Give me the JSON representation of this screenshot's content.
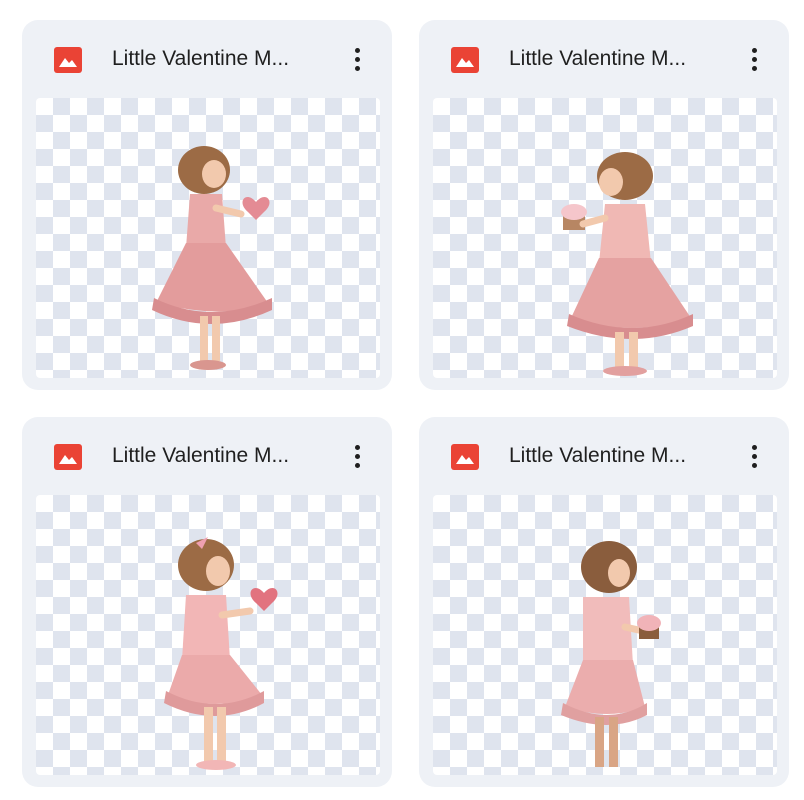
{
  "files": [
    {
      "title": "Little Valentine M...",
      "icon": "image-file-icon",
      "icon_color": "#ea4335",
      "thumbnail": "girl-holding-heart"
    },
    {
      "title": "Little Valentine M...",
      "icon": "image-file-icon",
      "icon_color": "#ea4335",
      "thumbnail": "girl-holding-cupcake"
    },
    {
      "title": "Little Valentine M...",
      "icon": "image-file-icon",
      "icon_color": "#ea4335",
      "thumbnail": "girl-holding-heart-bow"
    },
    {
      "title": "Little Valentine M...",
      "icon": "image-file-icon",
      "icon_color": "#ea4335",
      "thumbnail": "girl-holding-cupcake-side"
    }
  ],
  "colors": {
    "card_bg": "#eef1f6",
    "checker": "#dfe4ee",
    "dress": "#e9a9a8",
    "hair": "#9c6b45"
  }
}
